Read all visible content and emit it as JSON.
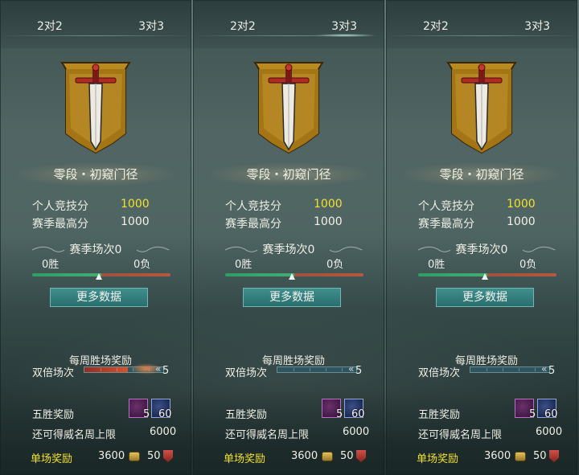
{
  "panels": [
    {
      "tabs": [
        "2对2",
        "3对3"
      ],
      "active_tab": 0,
      "rank": "零段・初窥门径",
      "stats": [
        {
          "label": "个人竞技分",
          "value": "1000",
          "highlight": true
        },
        {
          "label": "赛季最高分",
          "value": "1000",
          "highlight": false
        }
      ],
      "season_matches": "赛季场次0",
      "wins": "0胜",
      "losses": "0负",
      "win_ratio": 0.5,
      "more_button": "更多数据",
      "weekly_reward_title": "每周胜场奖励",
      "double_label": "双倍场次",
      "double_count": "5",
      "double_progress": 0.55,
      "five_win_label": "五胜奖励",
      "item_counts": [
        "5",
        "60"
      ],
      "limit_label": "还可得威名周上限",
      "limit_value": "6000",
      "single_label": "单场奖励",
      "single_values": [
        "3600",
        "50"
      ]
    },
    {
      "tabs": [
        "2对2",
        "3对3"
      ],
      "active_tab": 1,
      "rank": "零段・初窥门径",
      "stats": [
        {
          "label": "个人竞技分",
          "value": "1000",
          "highlight": true
        },
        {
          "label": "赛季最高分",
          "value": "1000",
          "highlight": false
        }
      ],
      "season_matches": "赛季场次0",
      "wins": "0胜",
      "losses": "0负",
      "win_ratio": 0.5,
      "more_button": "更多数据",
      "weekly_reward_title": "每周胜场奖励",
      "double_label": "双倍场次",
      "double_count": "5",
      "double_progress": 0,
      "five_win_label": "五胜奖励",
      "item_counts": [
        "5",
        "60"
      ],
      "limit_label": "还可得威名周上限",
      "limit_value": "6000",
      "single_label": "单场奖励",
      "single_values": [
        "3600",
        "50"
      ]
    },
    {
      "tabs": [
        "2对2",
        "3对3"
      ],
      "active_tab": -1,
      "rank": "零段・初窥门径",
      "stats": [
        {
          "label": "个人竞技分",
          "value": "1000",
          "highlight": true
        },
        {
          "label": "赛季最高分",
          "value": "1000",
          "highlight": false
        }
      ],
      "season_matches": "赛季场次0",
      "wins": "0胜",
      "losses": "0负",
      "win_ratio": 0.5,
      "more_button": "更多数据",
      "weekly_reward_title": "每周胜场奖励",
      "double_label": "双倍场次",
      "double_count": "5",
      "double_progress": 0,
      "five_win_label": "五胜奖励",
      "item_counts": [
        "5",
        "60"
      ],
      "limit_label": "还可得威名周上限",
      "limit_value": "6000",
      "single_label": "单场奖励",
      "single_values": [
        "3600",
        "50"
      ]
    }
  ],
  "colors": {
    "highlight": "#f3e130",
    "button": "#2f7a78",
    "win_bar": "#35a268",
    "loss_bar": "#b5583f",
    "emblem_gold": "#b98a1e"
  },
  "icons": [
    "sword-banner-emblem",
    "treasure-chest-icon",
    "blue-token-icon",
    "coin-icon",
    "badge-icon"
  ]
}
